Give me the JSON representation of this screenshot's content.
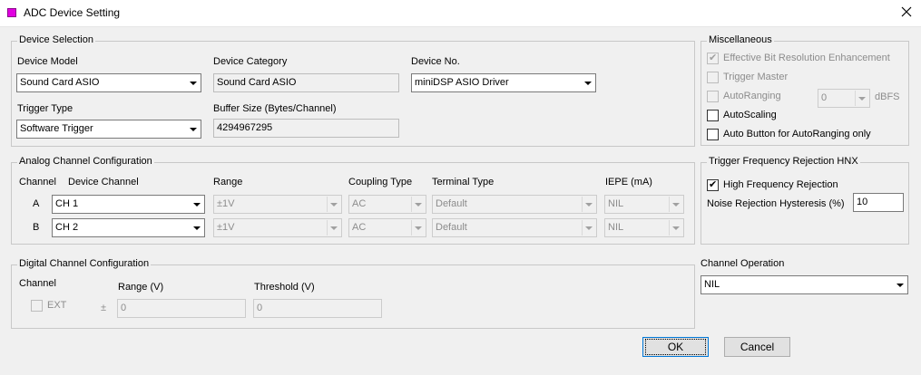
{
  "window": {
    "title": "ADC Device Setting"
  },
  "device_selection": {
    "legend": "Device Selection",
    "device_model_label": "Device Model",
    "device_model_value": "Sound Card ASIO",
    "device_category_label": "Device Category",
    "device_category_value": "Sound Card ASIO",
    "device_no_label": "Device No.",
    "device_no_value": "miniDSP ASIO Driver",
    "trigger_type_label": "Trigger Type",
    "trigger_type_value": "Software Trigger",
    "buffer_size_label": "Buffer Size (Bytes/Channel)",
    "buffer_size_value": "4294967295"
  },
  "analog": {
    "legend": "Analog Channel Configuration",
    "headers": {
      "channel": "Channel",
      "device_channel": "Device Channel",
      "range": "Range",
      "coupling": "Coupling Type",
      "terminal": "Terminal Type",
      "iepe": "IEPE (mA)"
    },
    "rows": [
      {
        "channel": "A",
        "device_channel": "CH 1",
        "range": "±1V",
        "coupling": "AC",
        "terminal": "Default",
        "iepe": "NIL"
      },
      {
        "channel": "B",
        "device_channel": "CH 2",
        "range": "±1V",
        "coupling": "AC",
        "terminal": "Default",
        "iepe": "NIL"
      }
    ]
  },
  "digital": {
    "legend": "Digital Channel Configuration",
    "channel_label": "Channel",
    "range_label": "Range (V)",
    "threshold_label": "Threshold (V)",
    "ext_label": "EXT",
    "pm_symbol": "±",
    "range_value": "0",
    "threshold_value": "0"
  },
  "misc": {
    "legend": "Miscellaneous",
    "ebre_label": "Effective Bit Resolution Enhancement",
    "trigger_master_label": "Trigger Master",
    "autoranging_label": "AutoRanging",
    "autoranging_value": "0",
    "dbfs_label": "dBFS",
    "autoscaling_label": "AutoScaling",
    "auto_button_label": "Auto Button for AutoRanging only"
  },
  "trigger_rejection": {
    "legend": "Trigger Frequency Rejection HNX",
    "hfr_label": "High Frequency Rejection",
    "hysteresis_label": "Noise Rejection Hysteresis (%)",
    "hysteresis_value": "10"
  },
  "channel_operation": {
    "label": "Channel Operation",
    "value": "NIL"
  },
  "buttons": {
    "ok": "OK",
    "cancel": "Cancel"
  }
}
